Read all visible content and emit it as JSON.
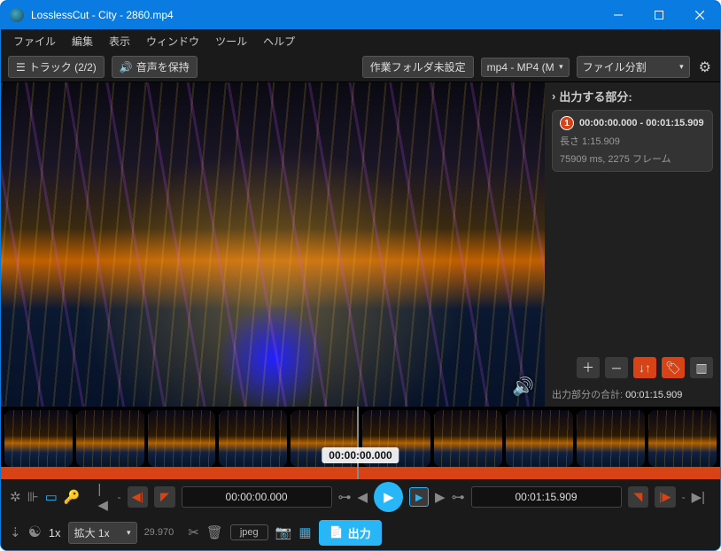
{
  "title": "LosslessCut - City - 2860.mp4",
  "menu": {
    "file": "ファイル",
    "edit": "編集",
    "view": "表示",
    "window": "ウィンドウ",
    "tools": "ツール",
    "help": "ヘルプ"
  },
  "toolbar": {
    "tracks": "トラック (2/2)",
    "keep_audio": "音声を保持",
    "workdir": "作業フォルダ未設定",
    "format": "mp4 - MP4 (M",
    "file_split": "ファイル分割"
  },
  "side": {
    "header": "出力する部分:",
    "seg_num": "1",
    "seg_range": "00:00:00.000 - 00:01:15.909",
    "seg_len": "長さ 1:15.909",
    "seg_info": "75909 ms, 2275 フレーム",
    "total_label": "出力部分の合計:",
    "total_value": "00:01:15.909"
  },
  "timeline": {
    "playhead": "00:00:00.000"
  },
  "controls": {
    "start_tc": "00:00:00.000",
    "end_tc": "00:01:15.909"
  },
  "bottom": {
    "speed": "1x",
    "zoom_label": "拡大 1x",
    "fps": "29.970",
    "capture_fmt": "jpeg",
    "export": "出力"
  }
}
